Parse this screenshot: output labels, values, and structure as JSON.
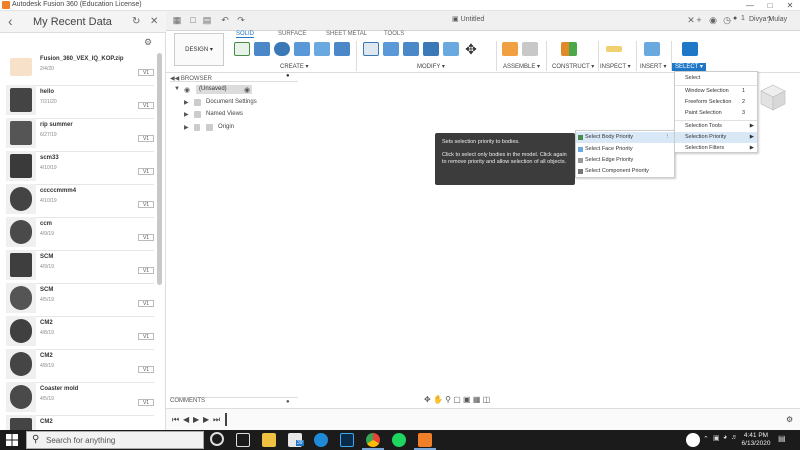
{
  "window": {
    "title": "Autodesk Fusion 360 (Education License)",
    "minimize": "—",
    "maximize": "□",
    "close": "✕"
  },
  "data_panel": {
    "title": "My Recent Data",
    "items": [
      {
        "name": "Fusion_360_VEX_IQ_KOP.zip",
        "date": "2/4/20",
        "version": "V1"
      },
      {
        "name": "hello",
        "date": "7/21/20",
        "version": "V1"
      },
      {
        "name": "rip summer",
        "date": "6/27/19",
        "version": "V1"
      },
      {
        "name": "scm33",
        "date": "4/10/19",
        "version": "V1"
      },
      {
        "name": "cccccmmm4",
        "date": "4/10/19",
        "version": "V1"
      },
      {
        "name": "ccm",
        "date": "4/9/19",
        "version": "V1"
      },
      {
        "name": "SCM",
        "date": "4/9/19",
        "version": "V1"
      },
      {
        "name": "SCM",
        "date": "4/5/19",
        "version": "V1"
      },
      {
        "name": "CM2",
        "date": "4/8/19",
        "version": "V1"
      },
      {
        "name": "CM2",
        "date": "4/8/19",
        "version": "V1"
      },
      {
        "name": "Coaster mold",
        "date": "4/5/19",
        "version": "V1"
      },
      {
        "name": "CM2",
        "date": "",
        "version": ""
      }
    ]
  },
  "appbar": {
    "document_tab": "Untitled",
    "notifications": "1",
    "user": "Divya Mulay"
  },
  "toolbar": {
    "workspace_button": "DESIGN ▾",
    "tabs": [
      "SOLID",
      "SURFACE",
      "SHEET METAL",
      "TOOLS"
    ],
    "groups": [
      "CREATE ▾",
      "MODIFY ▾",
      "ASSEMBLE ▾",
      "CONSTRUCT ▾",
      "INSPECT ▾",
      "INSERT ▾"
    ],
    "select_group": "SELECT ▾"
  },
  "browser": {
    "title": "BROWSER",
    "root": "(Unsaved)",
    "nodes": [
      "Document Settings",
      "Named Views",
      "Origin"
    ]
  },
  "tooltip": {
    "title": "Sets selection priority to bodies.",
    "body": "Click to select only bodies in the model. Click again to remove priority and allow selection of all objects."
  },
  "selection_priority_menu": {
    "items": [
      "Select Body Priority",
      "Select Face Priority",
      "Select Edge Priority",
      "Select Component Priority"
    ]
  },
  "select_menu": {
    "items": [
      {
        "label": "Select",
        "key": "",
        "arrow": ""
      },
      {
        "label": "Window Selection",
        "key": "1",
        "arrow": ""
      },
      {
        "label": "Freeform Selection",
        "key": "2",
        "arrow": ""
      },
      {
        "label": "Paint Selection",
        "key": "3",
        "arrow": ""
      },
      {
        "label": "Selection Tools",
        "key": "",
        "arrow": "▶"
      },
      {
        "label": "Selection Priority",
        "key": "",
        "arrow": "▶"
      },
      {
        "label": "Selection Filters",
        "key": "",
        "arrow": "▶"
      }
    ]
  },
  "comments": {
    "label": "COMMENTS"
  },
  "taskbar": {
    "search_placeholder": "Search for anything",
    "badge": "39",
    "time": "4:41 PM",
    "date": "6/13/2020"
  },
  "colors": {
    "accent": "#1f77c8",
    "taskbar": "#1b1b1b",
    "tooltip": "#3c3c3c"
  }
}
